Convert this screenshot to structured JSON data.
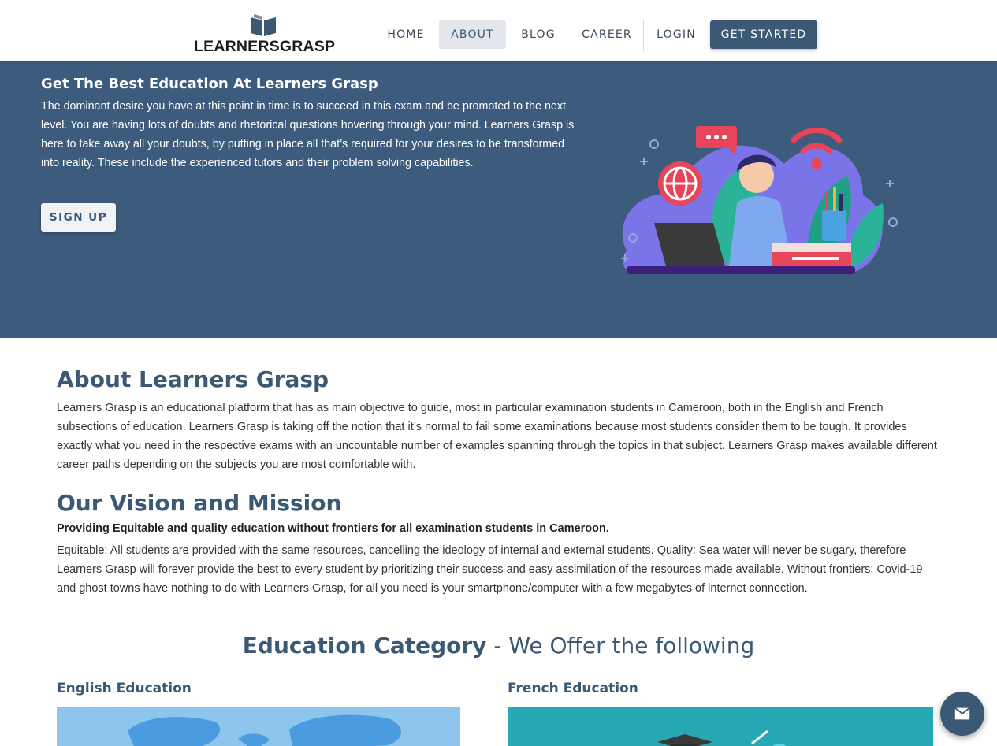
{
  "brand": {
    "logo_text": "LEARNERSGRASP"
  },
  "nav": {
    "home": "HOME",
    "about": "ABOUT",
    "blog": "BLOG",
    "career": "CAREER",
    "login": "LOGIN",
    "cta": "GET STARTED",
    "active": "ABOUT"
  },
  "hero": {
    "title": "Get The Best Education At Learners Grasp",
    "text": "The dominant desire you have at this point in time is to succeed in this exam and be promoted to the next level. You are having lots of doubts and rhetorical questions hovering through your mind. Learners Grasp is here to take away all your doubts, by putting in place all that’s required for your desires to be transformed into reality. These include the experienced tutors and their problem solving capabilities.",
    "button": "SIGN UP",
    "illustration": "student-at-laptop-illustration"
  },
  "about": {
    "heading": "About Learners Grasp",
    "text": "Learners Grasp is an educational platform that has as main objective to guide, most in particular examination students in Cameroon, both in the English and French subsections of education. Learners Grasp is taking off the notion that it’s normal to fail some examinations because most students consider them to be tough. It provides exactly what you need in the respective exams with an uncountable number of examples spanning through the topics in that subject. Learners Grasp makes available different career paths depending on the subjects you are most comfortable with."
  },
  "vision": {
    "heading": "Our Vision and Mission",
    "statement": "Providing Equitable and quality education without frontiers for all examination students in Cameroon.",
    "text": "Equitable: All students are provided with the same resources, cancelling the ideology of internal and external students. Quality: Sea water will never be sugary, therefore Learners Grasp will forever provide the best to every student by prioritizing their success and easy assimilation of the resources made available. Without frontiers: Covid-19 and ghost towns have nothing to do with Learners Grasp, for all you need is your smartphone/computer with a few megabytes of internet connection."
  },
  "education": {
    "heading_bold": "Education Category",
    "heading_rest": " - We Offer the following",
    "categories": [
      {
        "title": "English Education",
        "image": "world-map-image"
      },
      {
        "title": "French Education",
        "image": "graduation-image"
      }
    ]
  },
  "fab": {
    "icon": "mail-icon"
  },
  "colors": {
    "primary": "#3b5875",
    "hero_bg": "#3d5b7c",
    "nav_active_bg": "#e3e6ea",
    "english_img_bg": "#8ec5ec",
    "french_img_bg": "#27a9b5"
  }
}
